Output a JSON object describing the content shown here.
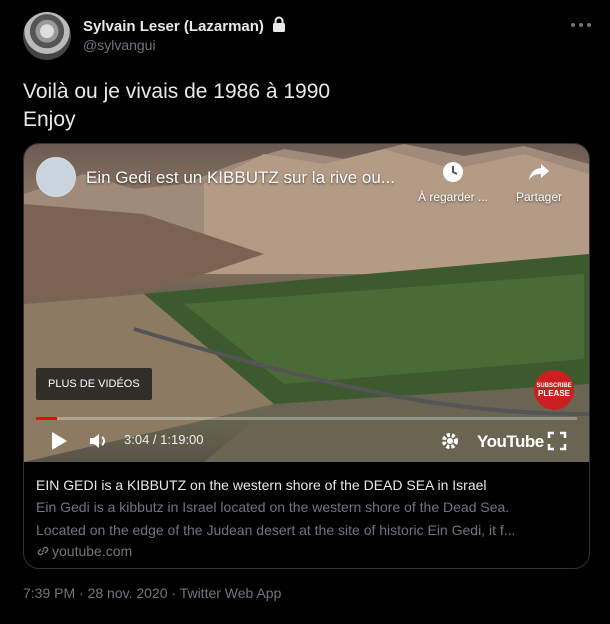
{
  "author": {
    "name": "Sylvain Leser (Lazarman)",
    "handle": "@sylvangui",
    "protected_icon": "lock-icon"
  },
  "more_icon": "more-horizontal-icon",
  "tweet": {
    "line1": "Voilà ou je vivais de 1986 à 1990",
    "line2": "Enjoy"
  },
  "video": {
    "title": "Ein Gedi est un KIBBUTZ sur la rive ou...",
    "watch_later_label": "À regarder ...",
    "share_label": "Partager",
    "more_videos_label": "PLUS DE VIDÉOS",
    "subscribe_line1": "SUBSCRIBE",
    "subscribe_line2": "PLEASE",
    "time": "3:04 / 1:19:00",
    "progress": 0.039,
    "youtube_label": "YouTube"
  },
  "card": {
    "title": "EIN GEDI is a KIBBUTZ on the western shore of the DEAD SEA in Israel",
    "desc_line1": "Ein Gedi is a kibbutz in Israel located on the western shore of the Dead Sea.",
    "desc_line2": "Located on the edge of the Judean desert at the site of historic Ein Gedi, it f...",
    "domain": "youtube.com"
  },
  "meta": {
    "footer": "7:39 PM · 28 nov. 2020 · Twitter Web App"
  },
  "colors": {
    "background": "#000000",
    "text": "#e7e9ea",
    "secondary": "#71767b",
    "youtube_red": "#ff0000"
  }
}
